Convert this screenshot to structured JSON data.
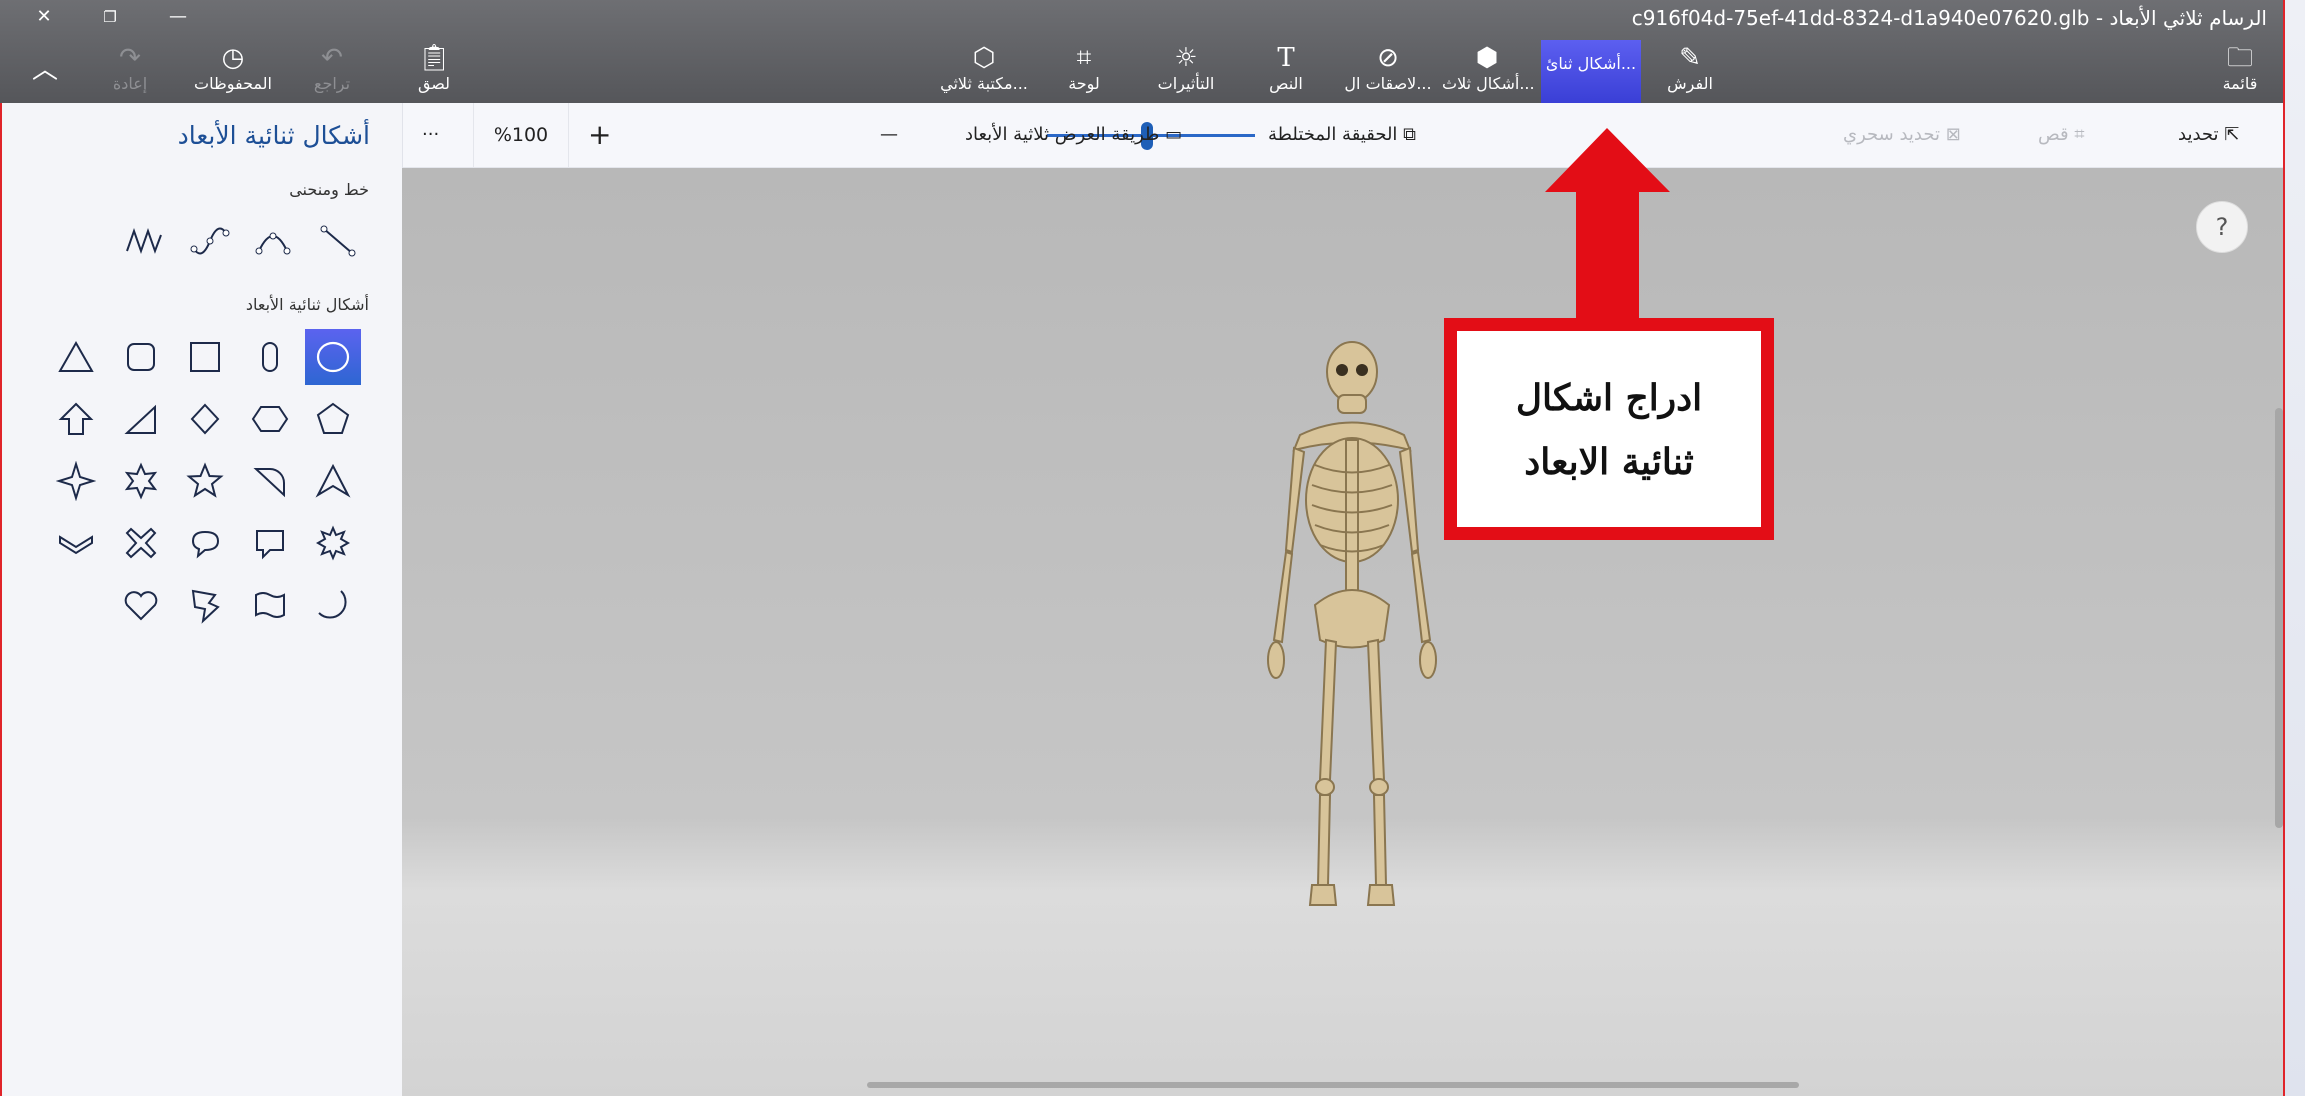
{
  "window": {
    "title": "c916f04d-75ef-41dd-8324-d1a940e07620.glb - الرسام ثلاثي الأبعاد",
    "close_glyph": "✕",
    "restore_glyph": "❐",
    "minimize_glyph": "—"
  },
  "ribbon": {
    "menu": "قائمة",
    "brushes": "الفرش",
    "shapes_2d": "أشكال ثنائ...",
    "shapes_3d": "أشكال ثلاث...",
    "stickers": "لاصقات ال...",
    "text": "النص",
    "effects": "التأثيرات",
    "canvas": "لوحة",
    "library_3d": "مكتبة ثلاثي...",
    "paste": "لصق",
    "undo": "تراجع",
    "history": "المحفوظات",
    "redo": "إعادة"
  },
  "toolbar": {
    "select": "تحديد",
    "crop": "قص",
    "magic_select": "تحديد سحري",
    "mixed_reality": "الحقيقة المختلطة",
    "view_3d": "طريقة العرض ثلاثية الأبعاد",
    "zoom_minus": "—",
    "zoom_plus": "+",
    "zoom_value": "%100",
    "zoom_fraction": 0.48,
    "more": "···"
  },
  "panel": {
    "title": "أشكال ثنائية الأبعاد",
    "section_lines": "خط ومنحنى",
    "section_shapes": "أشكال ثنائية الأبعاد",
    "selected_shape": "ellipse"
  },
  "canvas": {
    "help": "?",
    "callout_line1": "ادراج اشكال",
    "callout_line2": "ثنائية الابعاد",
    "callout_color": "#e30d16"
  }
}
